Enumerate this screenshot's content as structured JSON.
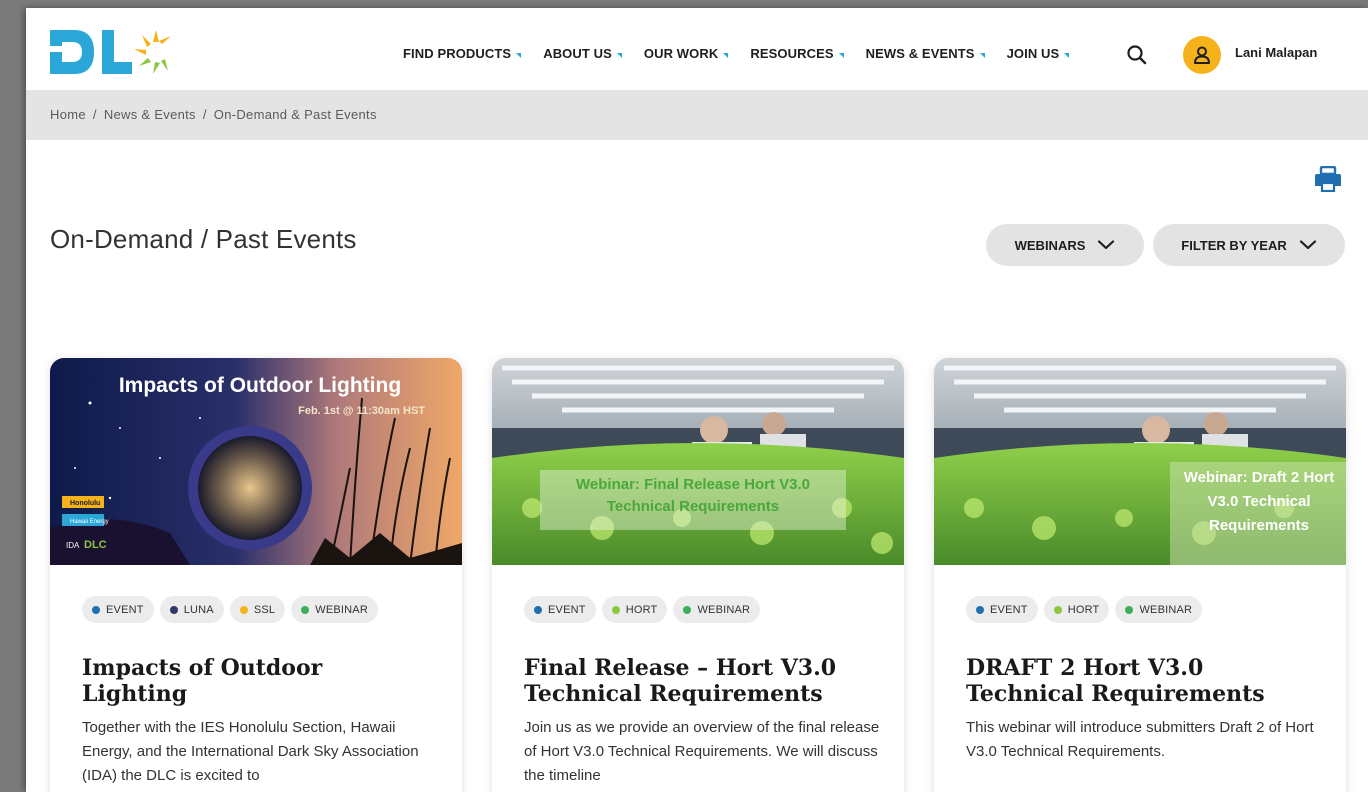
{
  "header": {
    "nav": [
      {
        "label": "FIND PRODUCTS"
      },
      {
        "label": "ABOUT US"
      },
      {
        "label": "OUR WORK"
      },
      {
        "label": "RESOURCES"
      },
      {
        "label": "NEWS & EVENTS"
      },
      {
        "label": "JOIN US"
      }
    ],
    "logo_text": "DLC",
    "user_name": "Lani Malapan"
  },
  "breadcrumb": [
    "Home",
    "News & Events",
    "On-Demand & Past Events"
  ],
  "page": {
    "title": "On-Demand / Past Events",
    "filters": [
      {
        "label": "WEBINARS"
      },
      {
        "label": "FILTER BY YEAR"
      }
    ]
  },
  "colors": {
    "accent_blue": "#1f6fb2",
    "navy": "#2f3a6a",
    "yellow": "#f6b21b",
    "green": "#3fae5a",
    "light_green": "#8cc63f"
  },
  "cards": [
    {
      "image_title": "Impacts of Outdoor Lighting",
      "image_subtitle": "Feb. 1st @ 11:30am HST",
      "image_logos": [
        "Honolulu",
        "Hawaii Energy",
        "IDA",
        "DLC"
      ],
      "tags": [
        {
          "label": "EVENT",
          "color": "#1f6fb2"
        },
        {
          "label": "LUNA",
          "color": "#2f3a6a"
        },
        {
          "label": "SSL",
          "color": "#f6b21b"
        },
        {
          "label": "WEBINAR",
          "color": "#3fae5a"
        }
      ],
      "title": "Impacts of Outdoor Lighting",
      "description": "Together with the IES Honolulu Section, Hawaii Energy,  and the International Dark Sky Association (IDA) the DLC is excited to"
    },
    {
      "image_overlay": "Webinar: Final Release Hort V3.0 Technical Requirements",
      "tags": [
        {
          "label": "EVENT",
          "color": "#1f6fb2"
        },
        {
          "label": "HORT",
          "color": "#8cc63f"
        },
        {
          "label": "WEBINAR",
          "color": "#3fae5a"
        }
      ],
      "title": "Final Release – Hort V3.0 Technical Requirements",
      "description": "Join us as we provide an overview of the final release of Hort V3.0 Technical Requirements. We will discuss the timeline"
    },
    {
      "image_overlay": "Webinar: Draft 2 Hort V3.0 Technical Requirements",
      "tags": [
        {
          "label": "EVENT",
          "color": "#1f6fb2"
        },
        {
          "label": "HORT",
          "color": "#8cc63f"
        },
        {
          "label": "WEBINAR",
          "color": "#3fae5a"
        }
      ],
      "title": "DRAFT 2 Hort V3.0 Technical Requirements",
      "description": "This webinar will introduce submitters Draft 2 of Hort V3.0 Technical Requirements."
    }
  ]
}
